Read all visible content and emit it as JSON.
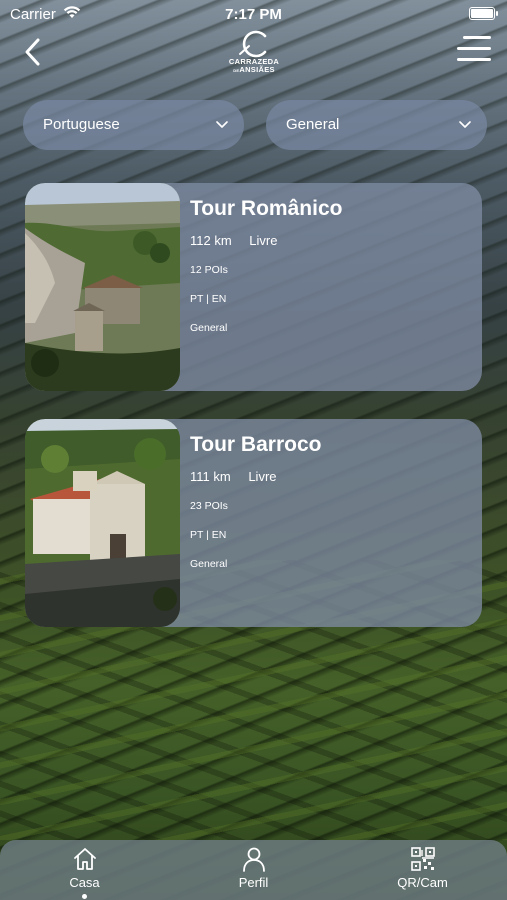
{
  "status_bar": {
    "carrier": "Carrier",
    "time": "7:17 PM"
  },
  "header": {
    "logo_line1": "CARRAZEDA",
    "logo_line2": "ANSIÃES",
    "logo_small": "DE"
  },
  "filters": {
    "language": "Portuguese",
    "category": "General"
  },
  "tours": [
    {
      "name": "Tour Românico",
      "distance": "112 km",
      "price": "Livre",
      "pois": "12 POIs",
      "languages": "PT | EN",
      "category": "General"
    },
    {
      "name": "Tour Barroco",
      "distance": "111 km",
      "price": "Livre",
      "pois": "23 POIs",
      "languages": "PT | EN",
      "category": "General"
    }
  ],
  "tabbar": [
    {
      "label": "Casa",
      "icon": "home-icon"
    },
    {
      "label": "Perfil",
      "icon": "person-icon"
    },
    {
      "label": "QR/Cam",
      "icon": "qr-code-icon"
    }
  ]
}
